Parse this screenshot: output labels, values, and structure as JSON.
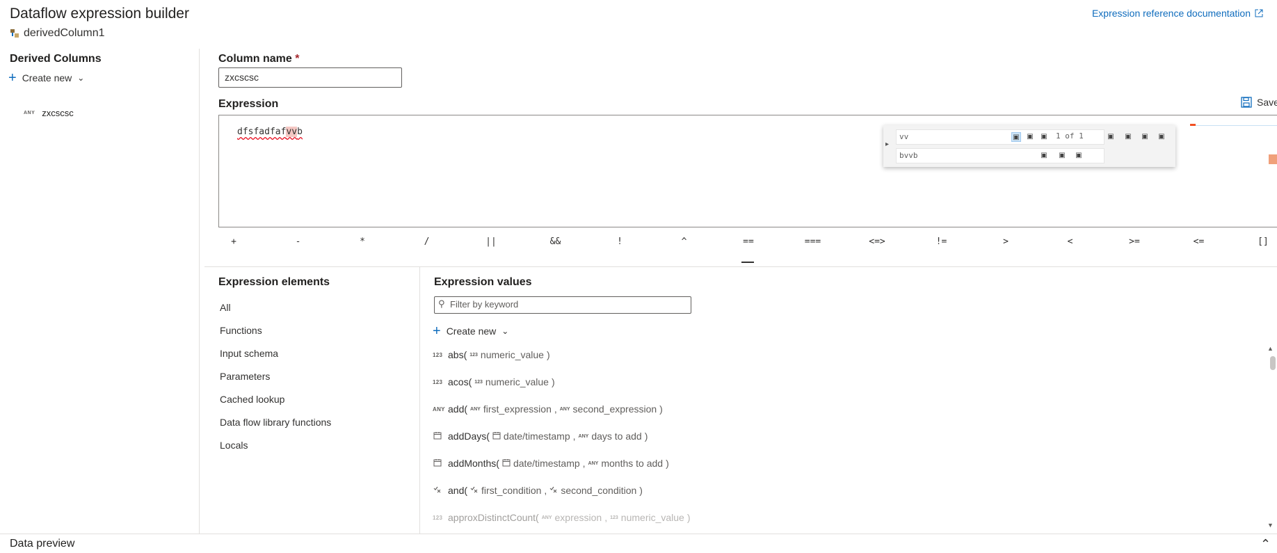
{
  "header": {
    "title": "Dataflow expression builder",
    "subtitle": "derivedColumn1",
    "doc_link": "Expression reference documentation"
  },
  "derived_columns": {
    "title": "Derived Columns",
    "create_new": "Create new",
    "items": [
      {
        "type": "ANY",
        "name": "zxcscsc"
      }
    ]
  },
  "column_name": {
    "label": "Column name",
    "required_mark": "*",
    "value": "zxcscsc"
  },
  "expression": {
    "label": "Expression",
    "save_label": "Save",
    "text_before": "dfsfadfaf",
    "text_match": "vv",
    "text_after": "b",
    "find": {
      "search_value": "vv",
      "replace_value": "bvvb",
      "count": "1 of 1"
    }
  },
  "operators": [
    "+",
    "-",
    "*",
    "/",
    "||",
    "&&",
    "!",
    "^",
    "==",
    "===",
    "<=>",
    "!=",
    ">",
    "<",
    ">=",
    "<=",
    "[]"
  ],
  "operators_selected": "==",
  "expression_elements": {
    "title": "Expression elements",
    "items": [
      "All",
      "Functions",
      "Input schema",
      "Parameters",
      "Cached lookup",
      "Data flow library functions",
      "Locals"
    ]
  },
  "expression_values": {
    "title": "Expression values",
    "filter_placeholder": "Filter by keyword",
    "create_new": "Create new",
    "functions": [
      {
        "type": "123",
        "name": "abs(",
        "params": [
          {
            "type": "123",
            "name": "numeric_value"
          }
        ]
      },
      {
        "type": "123",
        "name": "acos(",
        "params": [
          {
            "type": "123",
            "name": "numeric_value"
          }
        ]
      },
      {
        "type": "ANY",
        "name": "add(",
        "params": [
          {
            "type": "ANY",
            "name": "first_expression"
          },
          {
            "type": "ANY",
            "name": "second_expression"
          }
        ]
      },
      {
        "type": "calendar-icon",
        "name": "addDays(",
        "params": [
          {
            "type": "calendar-icon",
            "name": "date/timestamp"
          },
          {
            "type": "ANY",
            "name": "days to add"
          }
        ]
      },
      {
        "type": "calendar-icon",
        "name": "addMonths(",
        "params": [
          {
            "type": "calendar-icon",
            "name": "date/timestamp"
          },
          {
            "type": "ANY",
            "name": "months to add"
          }
        ]
      },
      {
        "type": "boolean-icon",
        "name": "and(",
        "params": [
          {
            "type": "boolean-icon",
            "name": "first_condition"
          },
          {
            "type": "boolean-icon",
            "name": "second_condition"
          }
        ]
      },
      {
        "type": "123",
        "name": "approxDistinctCount(",
        "params": [
          {
            "type": "ANY",
            "name": "expression"
          },
          {
            "type": "123",
            "name": "numeric_value"
          }
        ]
      }
    ]
  },
  "footer": {
    "data_preview": "Data preview"
  },
  "colors": {
    "accent": "#0f6cbd",
    "required": "#a4262c",
    "error_underline": "#e81123",
    "match_highlight": "#f4c7c3"
  }
}
